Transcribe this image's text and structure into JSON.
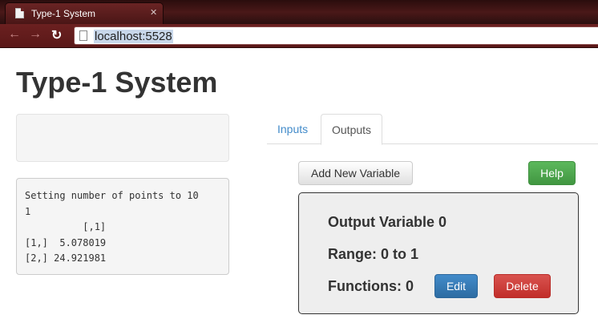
{
  "browser": {
    "tab_title": "Type-1 System",
    "url": "localhost:5528"
  },
  "icons": {
    "back": "back-arrow-icon",
    "forward": "forward-arrow-icon",
    "reload": "reload-icon",
    "page": "page-icon",
    "close": "close-icon"
  },
  "page": {
    "title": "Type-1 System"
  },
  "console": {
    "lines": [
      "Setting number of points to 10",
      "1",
      "          [,1]",
      "[1,]  5.078019",
      "[2,] 24.921981"
    ]
  },
  "tabs": {
    "inputs": "Inputs",
    "outputs": "Outputs",
    "active": "Outputs"
  },
  "toolbar": {
    "add_label": "Add New Variable",
    "help_label": "Help"
  },
  "variable": {
    "name": "Output Variable 0",
    "range": "Range: 0 to 1",
    "functions": "Functions: 0",
    "edit_label": "Edit",
    "delete_label": "Delete"
  },
  "colors": {
    "primary": "#428bca",
    "success": "#5cb85c",
    "danger": "#d9534f",
    "chrome": "#5a1818"
  }
}
